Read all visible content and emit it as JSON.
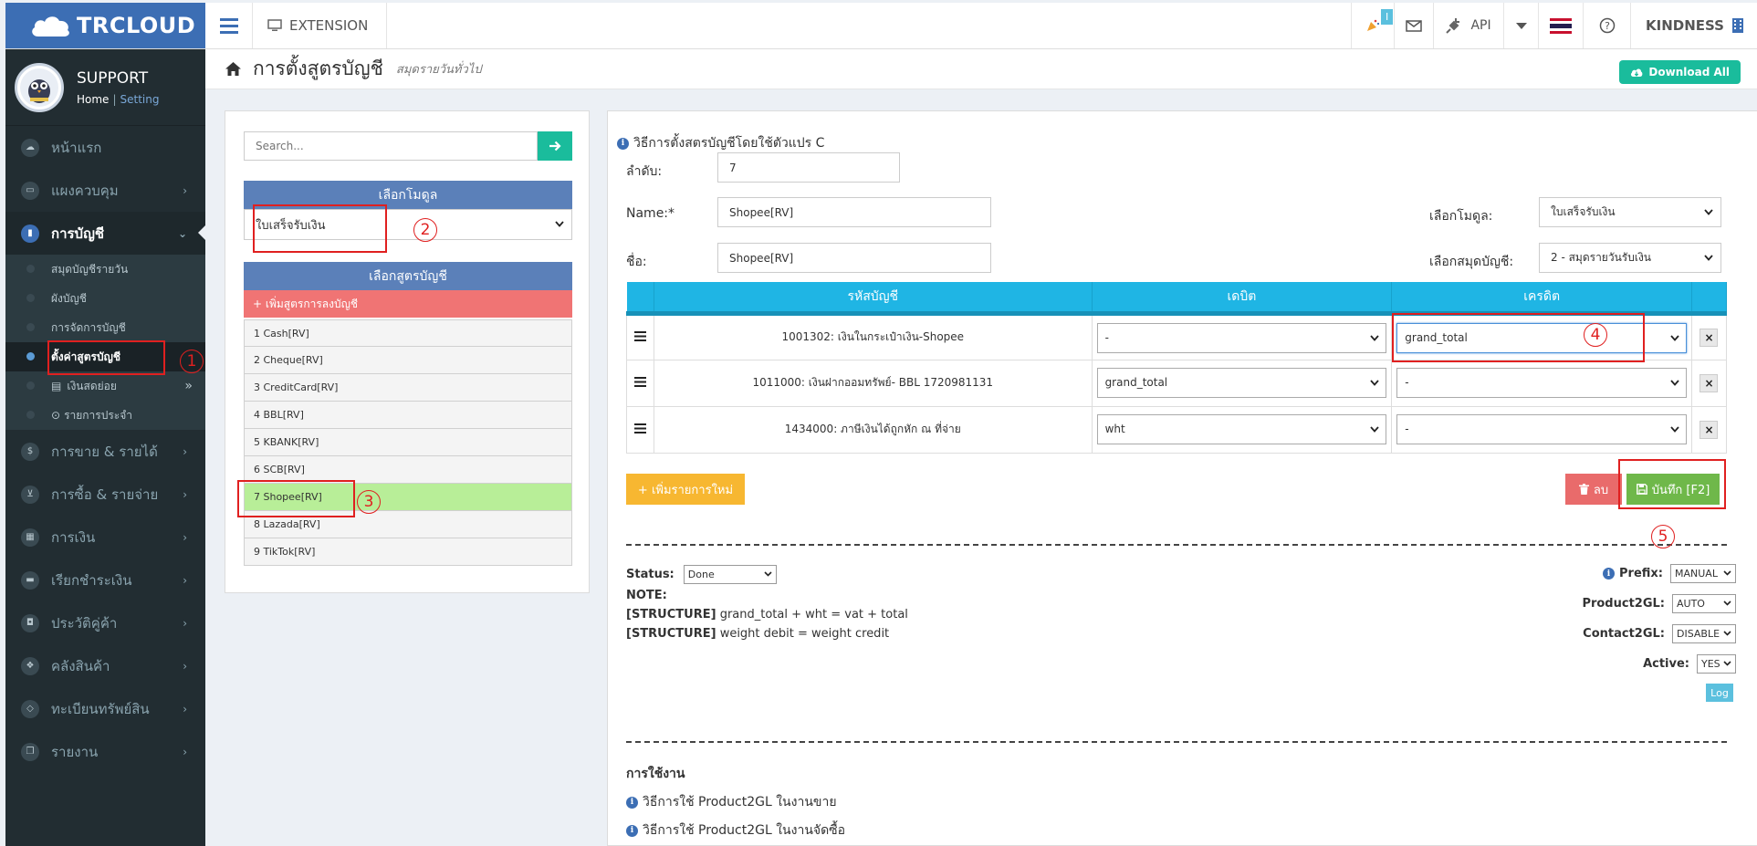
{
  "topbar": {
    "brand": "TRCLOUD",
    "extension_label": "EXTENSION",
    "notification_badge": "I",
    "api_label": "API",
    "company": "KINDNESS"
  },
  "sidebar": {
    "user_name": "SUPPORT",
    "home_link": "Home",
    "separator": "|",
    "setting_link": "Setting",
    "menu": [
      {
        "label": "หน้าแรก"
      },
      {
        "label": "แผงควบคุม"
      },
      {
        "label": "การบัญชี"
      },
      {
        "label": "การขาย & รายได้"
      },
      {
        "label": "การซื้อ & รายจ่าย"
      },
      {
        "label": "การเงิน"
      },
      {
        "label": "เรียกชำระเงิน"
      },
      {
        "label": "ประวัติคู่ค้า"
      },
      {
        "label": "คลังสินค้า"
      },
      {
        "label": "ทะเบียนทรัพย์สิน"
      },
      {
        "label": "รายงาน"
      }
    ],
    "submenu": [
      {
        "label": "สมุดบัญชีรายวัน"
      },
      {
        "label": "ผังบัญชี"
      },
      {
        "label": "การจัดการบัญชี"
      },
      {
        "label": "ตั้งค่าสูตรบัญชี"
      },
      {
        "label": "เงินสดย่อย"
      },
      {
        "label": "รายการประจำ"
      }
    ]
  },
  "header": {
    "title": "การตั้งสูตรบัญชี",
    "subtitle": "สมุดรายวันทั่วไป",
    "download_label": "Download All"
  },
  "left_panel": {
    "search_placeholder": "Search...",
    "module_header": "เลือกโมดูล",
    "module_value": "ใบเสร็จรับเงิน",
    "formula_header": "เลือกสูตรบัญชี",
    "add_formula_label": "+ เพิ่มสูตรการลงบัญชี",
    "formulas": [
      {
        "label": "1 Cash[RV]"
      },
      {
        "label": "2 Cheque[RV]"
      },
      {
        "label": "3 CreditCard[RV]"
      },
      {
        "label": "4 BBL[RV]"
      },
      {
        "label": "5 KBANK[RV]"
      },
      {
        "label": "6 SCB[RV]"
      },
      {
        "label": "7 Shopee[RV]"
      },
      {
        "label": "8 Lazada[RV]"
      },
      {
        "label": "9 TikTok[RV]"
      }
    ]
  },
  "form": {
    "info_text": "วิธีการตั้งสตรบัญชีโดยใช้ตัวแปร C",
    "order_label": "ลำดับ:",
    "order_value": "7",
    "name_label": "Name:*",
    "name_value": "Shopee[RV]",
    "thai_name_label": "ชื่อ:",
    "thai_name_value": "Shopee[RV]",
    "module_label": "เลือกโมดูล:",
    "module_value": "ใบเสร็จรับเงิน",
    "journal_label": "เลือกสมุดบัญชี:",
    "journal_value": "2 - สมุดรายวันรับเงิน"
  },
  "table": {
    "headers": [
      "รหัสบัญชี",
      "เดบิต",
      "เครดิต"
    ],
    "rows": [
      {
        "account": "1001302: เงินในกระเป๋าเงิน-Shopee",
        "debit": "-",
        "credit": "grand_total"
      },
      {
        "account": "1011000: เงินฝากออมทรัพย์- BBL 1720981131",
        "debit": "grand_total",
        "credit": "-"
      },
      {
        "account": "1434000: ภาษีเงินได้ถูกหัก ณ ที่จ่าย",
        "debit": "wht",
        "credit": "-"
      }
    ],
    "remove_symbol": "×"
  },
  "actions": {
    "add_row_label": "+ เพิ่มรายการใหม่",
    "delete_label": "ลบ",
    "save_label": "บันทึก [F2]"
  },
  "status": {
    "status_label": "Status:",
    "status_value": "Done",
    "note_label": "NOTE:",
    "structure_1_tag": "[STRUCTURE]",
    "structure_1_text": "grand_total + wht = vat + total",
    "structure_2_tag": "[STRUCTURE]",
    "structure_2_text": "weight debit = weight credit",
    "prefix_label": "Prefix:",
    "prefix_value": "MANUAL",
    "product2gl_label": "Product2GL:",
    "product2gl_value": "AUTO",
    "contact2gl_label": "Contact2GL:",
    "contact2gl_value": "DISABLE",
    "active_label": "Active:",
    "active_value": "YES",
    "log_label": "Log"
  },
  "usage": {
    "title": "การใช้งาน",
    "link_1": "วิธีการใช้ Product2GL ในงานขาย",
    "link_2": "วิธีการใช้ Product2GL ในงานจัดซื้อ"
  },
  "annotations": [
    "1",
    "2",
    "3",
    "4",
    "5"
  ],
  "colors": {
    "brand_blue": "#3c6eb4",
    "sidebar_bg": "#222d32",
    "table_header": "#1fb5e4",
    "save_green": "#6fb84a",
    "delete_red": "#e96b6b",
    "add_yellow": "#f7b731",
    "annotation_red": "#e02020"
  }
}
